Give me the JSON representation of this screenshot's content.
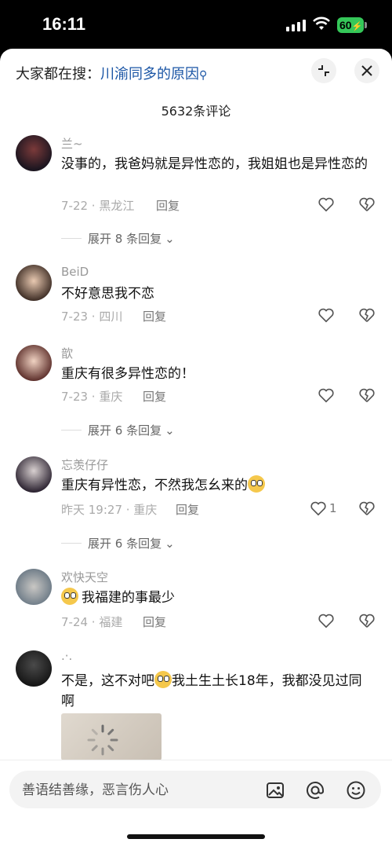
{
  "status": {
    "time": "16:11",
    "battery": "60"
  },
  "header": {
    "search_prefix": "大家都在搜：",
    "search_query": "川渝同多的原因",
    "comment_count": "5632条评论"
  },
  "comments": [
    {
      "user": "兰~",
      "text": "没事的，我爸妈就是异性恋的，我姐姐也是异性恋的",
      "meta": "7-22 · 黑龙江",
      "reply": "回复",
      "likes": "",
      "expand": "展开 8 条回复"
    },
    {
      "user": "BeiD",
      "text": "不好意思我不恋",
      "meta": "7-23 · 四川",
      "reply": "回复",
      "likes": ""
    },
    {
      "user": "歆",
      "text": "重庆有很多异性恋的！",
      "meta": "7-23 · 重庆",
      "reply": "回复",
      "likes": "",
      "expand": "展开 6 条回复"
    },
    {
      "user": "忘羡仔仔",
      "text": "重庆有异性恋，不然我怎幺来的",
      "meta": "昨天 19:27 · 重庆",
      "reply": "回复",
      "likes": "1",
      "expand": "展开 6 条回复"
    },
    {
      "user": "欢快天空",
      "text": "我福建的事最少",
      "meta": "7-24 · 福建",
      "reply": "回复",
      "likes": ""
    },
    {
      "user": ".·.",
      "text_a": "不是，这不对吧",
      "text_b": "我土生土长18年，我都没见过同啊"
    }
  ],
  "input": {
    "placeholder": "善语结善缘，恶言伤人心"
  }
}
